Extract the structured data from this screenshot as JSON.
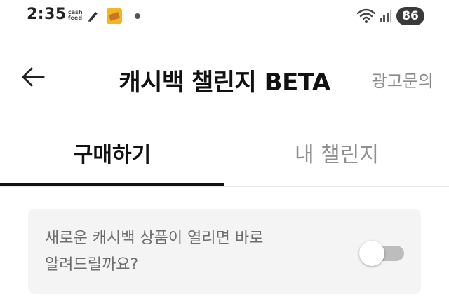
{
  "status_bar": {
    "time": "2:35",
    "cashfeed_label": "cash feed",
    "battery": "86",
    "icons": [
      "cashfeed-app-icon",
      "notification-app-icon",
      "notification-dot",
      "wifi-icon",
      "signal-icon",
      "battery-badge"
    ]
  },
  "header": {
    "back_icon": "arrow-left-icon",
    "title": "캐시백 챌린지 BETA",
    "ad_inquiry": "광고문의"
  },
  "tabs": [
    {
      "label": "구매하기",
      "selected": true
    },
    {
      "label": "내 챌린지",
      "selected": false
    }
  ],
  "notify_card": {
    "line1": "새로운 캐시백 상품이 열리면 바로",
    "line2": "알려드릴까요?",
    "toggle_on": false
  },
  "colors": {
    "title": "#111111",
    "muted_text": "#8a8a8a",
    "card_background": "#f4f4f4",
    "toggle_track_off": "#bdbdbd",
    "tab_indicator": "#111111"
  }
}
